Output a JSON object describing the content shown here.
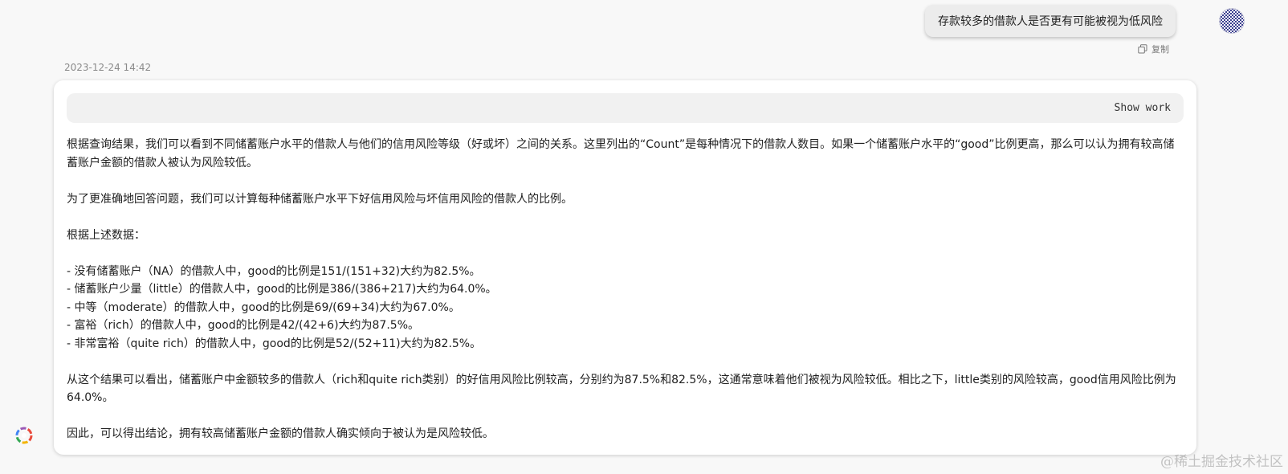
{
  "user_message": {
    "text": "存款较多的借款人是否更有可能被视为低风险",
    "copy_label": "复制"
  },
  "timestamp": "2023-12-24 14:42",
  "answer": {
    "show_work_label": "Show work",
    "paragraphs": [
      "根据查询结果，我们可以看到不同储蓄账户水平的借款人与他们的信用风险等级（好或坏）之间的关系。这里列出的“Count”是每种情况下的借款人数目。如果一个储蓄账户水平的“good”比例更高，那么可以认为拥有较高储蓄账户金额的借款人被认为风险较低。",
      "为了更准确地回答问题，我们可以计算每种储蓄账户水平下好信用风险与坏信用风险的借款人的比例。",
      "根据上述数据："
    ],
    "bullets": [
      "- 没有储蓄账户（NA）的借款人中，good的比例是151/(151+32)大约为82.5%。",
      "- 储蓄账户少量（little）的借款人中，good的比例是386/(386+217)大约为64.0%。",
      "- 中等（moderate）的借款人中，good的比例是69/(69+34)大约为67.0%。",
      "- 富裕（rich）的借款人中，good的比例是42/(42+6)大约为87.5%。",
      "- 非常富裕（quite rich）的借款人中，good的比例是52/(52+11)大约为82.5%。"
    ],
    "conclusion": "从这个结果可以看出，储蓄账户中金额较多的借款人（rich和quite rich类别）的好信用风险比例较高，分别约为87.5%和82.5%，这通常意味着他们被视为风险较低。相比之下，little类别的风险较高，good信用风险比例为64.0%。",
    "final": "因此，可以得出结论，拥有较高储蓄账户金额的借款人确实倾向于被认为是风险较低。"
  },
  "watermark": "@稀土掘金技术社区",
  "icons": {
    "avatar": "user-avatar-pattern",
    "copy": "copy-icon",
    "logo": "app-logo-icon"
  },
  "colors": {
    "background": "#f8f8f8",
    "card": "#ffffff",
    "bubble": "#ececec",
    "show_work_bar": "#f1f1f1",
    "avatar_primary": "#3b3f8f"
  }
}
